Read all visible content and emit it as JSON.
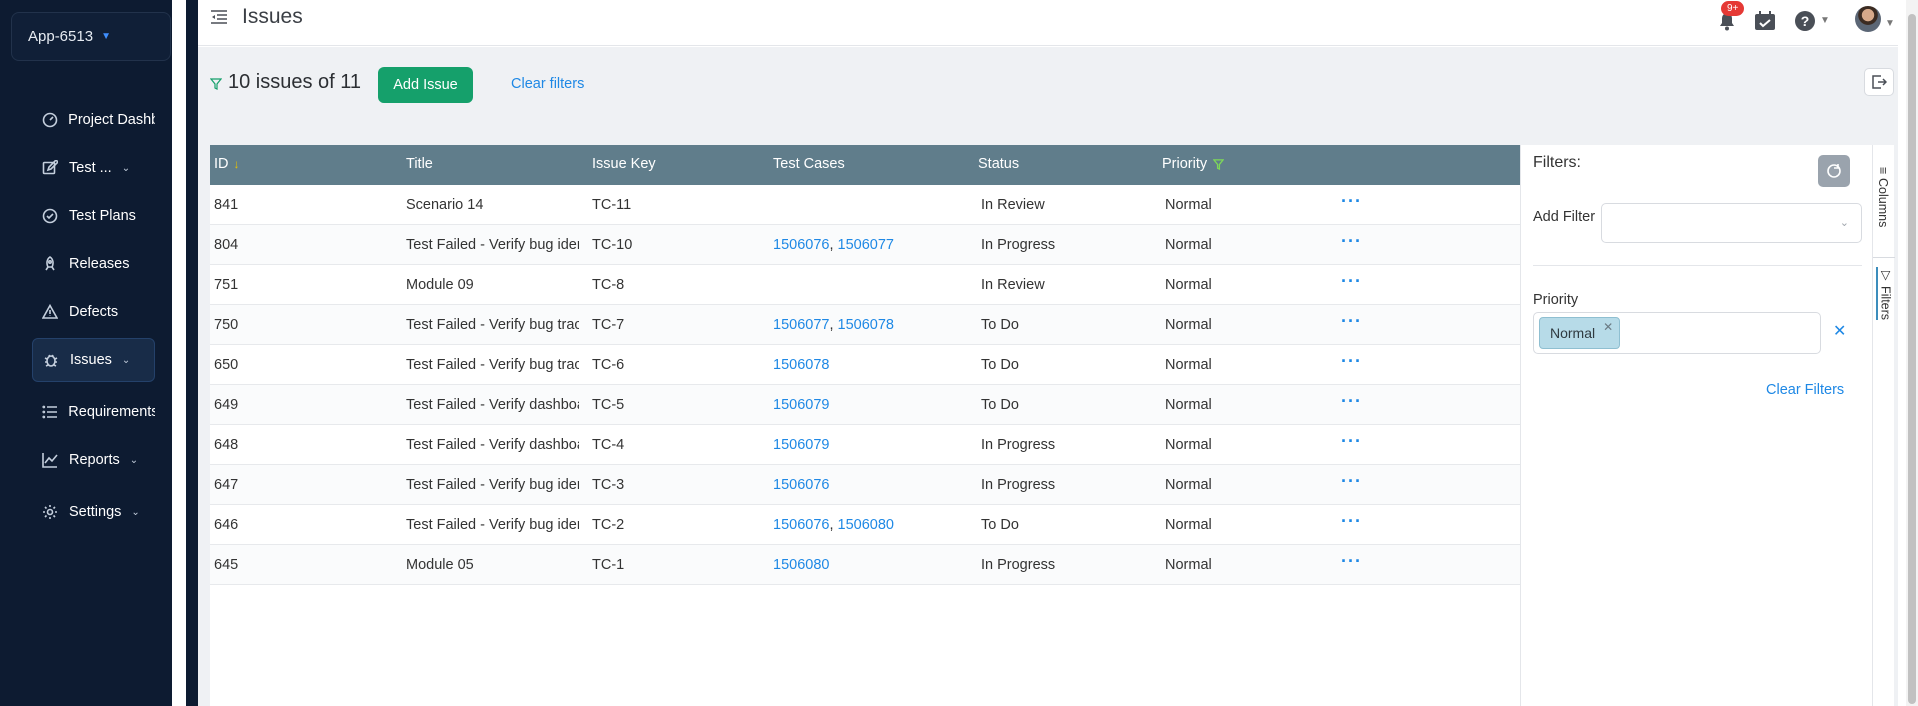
{
  "app": {
    "name": "App-6513"
  },
  "sidebar": {
    "items": [
      {
        "label": "Project Dashb",
        "icon": "dashboard-icon",
        "chevron": false
      },
      {
        "label": "Test ...",
        "icon": "edit-icon",
        "chevron": true
      },
      {
        "label": "Test Plans",
        "icon": "check-circle-icon",
        "chevron": false
      },
      {
        "label": "Releases",
        "icon": "rocket-icon",
        "chevron": false
      },
      {
        "label": "Defects",
        "icon": "warning-icon",
        "chevron": false
      },
      {
        "label": "Issues",
        "icon": "bug-icon",
        "chevron": true,
        "active": true
      },
      {
        "label": "Requirements",
        "icon": "list-icon",
        "chevron": false
      },
      {
        "label": "Reports",
        "icon": "chart-icon",
        "chevron": true
      },
      {
        "label": "Settings",
        "icon": "gear-icon",
        "chevron": true
      }
    ]
  },
  "header": {
    "title": "Issues",
    "notification_badge": "9+"
  },
  "toolbar": {
    "count_text": "10 issues of 11",
    "add_issue_label": "Add Issue",
    "clear_filters_label": "Clear filters"
  },
  "table": {
    "columns": [
      "ID",
      "Title",
      "Issue Key",
      "Test Cases",
      "Status",
      "Priority"
    ],
    "rows": [
      {
        "id": "841",
        "title": "Scenario 14",
        "key": "TC-11",
        "cases": [],
        "status": "In Review",
        "priority": "Normal"
      },
      {
        "id": "804",
        "title": "Test Failed - Verify bug iden",
        "key": "TC-10",
        "cases": [
          "1506076",
          "1506077"
        ],
        "status": "In Progress",
        "priority": "Normal"
      },
      {
        "id": "751",
        "title": "Module 09",
        "key": "TC-8",
        "cases": [],
        "status": "In Review",
        "priority": "Normal"
      },
      {
        "id": "750",
        "title": "Test Failed - Verify bug tracl",
        "key": "TC-7",
        "cases": [
          "1506077",
          "1506078"
        ],
        "status": "To Do",
        "priority": "Normal"
      },
      {
        "id": "650",
        "title": "Test Failed - Verify bug tracl",
        "key": "TC-6",
        "cases": [
          "1506078"
        ],
        "status": "To Do",
        "priority": "Normal"
      },
      {
        "id": "649",
        "title": "Test Failed - Verify dashboa",
        "key": "TC-5",
        "cases": [
          "1506079"
        ],
        "status": "To Do",
        "priority": "Normal"
      },
      {
        "id": "648",
        "title": "Test Failed - Verify dashboa",
        "key": "TC-4",
        "cases": [
          "1506079"
        ],
        "status": "In Progress",
        "priority": "Normal"
      },
      {
        "id": "647",
        "title": "Test Failed - Verify bug iden",
        "key": "TC-3",
        "cases": [
          "1506076"
        ],
        "status": "In Progress",
        "priority": "Normal"
      },
      {
        "id": "646",
        "title": "Test Failed - Verify bug iden",
        "key": "TC-2",
        "cases": [
          "1506076",
          "1506080"
        ],
        "status": "To Do",
        "priority": "Normal"
      },
      {
        "id": "645",
        "title": "Module 05",
        "key": "TC-1",
        "cases": [
          "1506080"
        ],
        "status": "In Progress",
        "priority": "Normal"
      }
    ]
  },
  "filters_panel": {
    "title": "Filters:",
    "add_filter_label": "Add Filter",
    "priority_label": "Priority",
    "priority_chip": "Normal",
    "clear_label": "Clear Filters"
  },
  "side_tabs": {
    "columns": "Columns",
    "filters": "Filters"
  },
  "colors": {
    "sidebar_bg": "#0d1b31",
    "header_row_bg": "#607d8b",
    "accent_green": "#15a06b",
    "link_blue": "#1e88e5",
    "chip_bg": "#b7dbe8"
  }
}
